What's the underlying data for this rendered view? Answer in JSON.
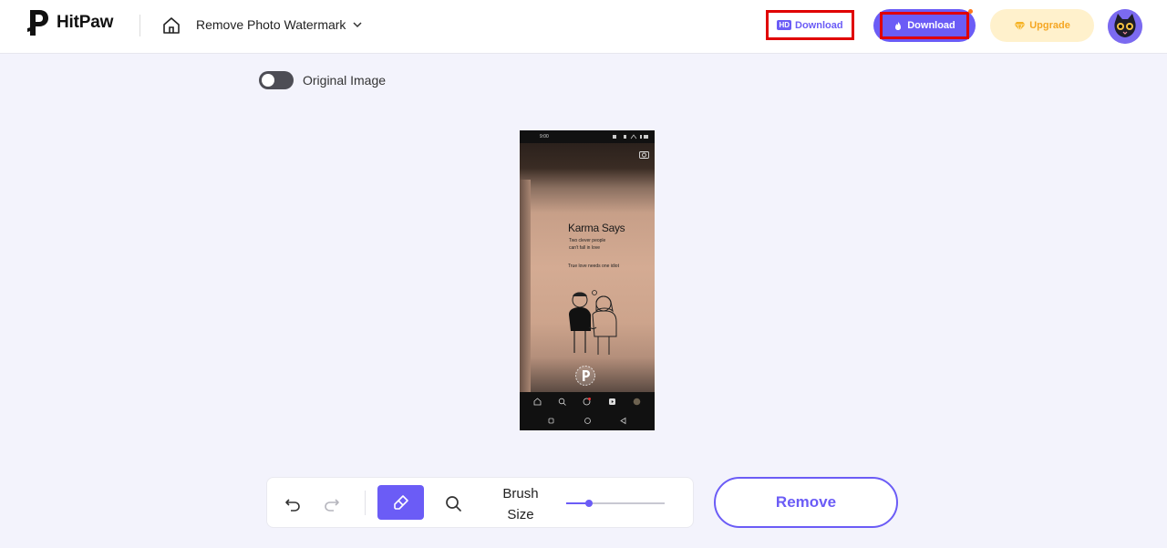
{
  "header": {
    "brand": "HitPaw",
    "tool_name": "Remove Photo Watermark",
    "hd_badge": "HD",
    "hd_download_label": "Download",
    "download_label": "Download",
    "upgrade_label": "Upgrade",
    "icons": [
      "hitpaw-logo-icon",
      "home-icon",
      "chevron-down-icon",
      "diamond-icon",
      "gem-icon",
      "avatar-cat"
    ]
  },
  "canvas": {
    "toggle_label": "Original Image",
    "toggle_on": false,
    "phone": {
      "status_time": "9:00",
      "book_title": "Karma Says",
      "line1": "Two clever people",
      "line2": "can't fall in love",
      "line3": "True love needs one idiot"
    }
  },
  "toolbar": {
    "brush_label_line1": "Brush",
    "brush_label_line2": "Size",
    "brush_size_fraction": 0.23
  },
  "actions": {
    "remove_label": "Remove"
  },
  "colors": {
    "accent": "#6b5cf6",
    "highlight_red": "#e00000",
    "upgrade_bg": "#fff1cc",
    "upgrade_text": "#f5a623",
    "background": "#f3f3fc"
  }
}
